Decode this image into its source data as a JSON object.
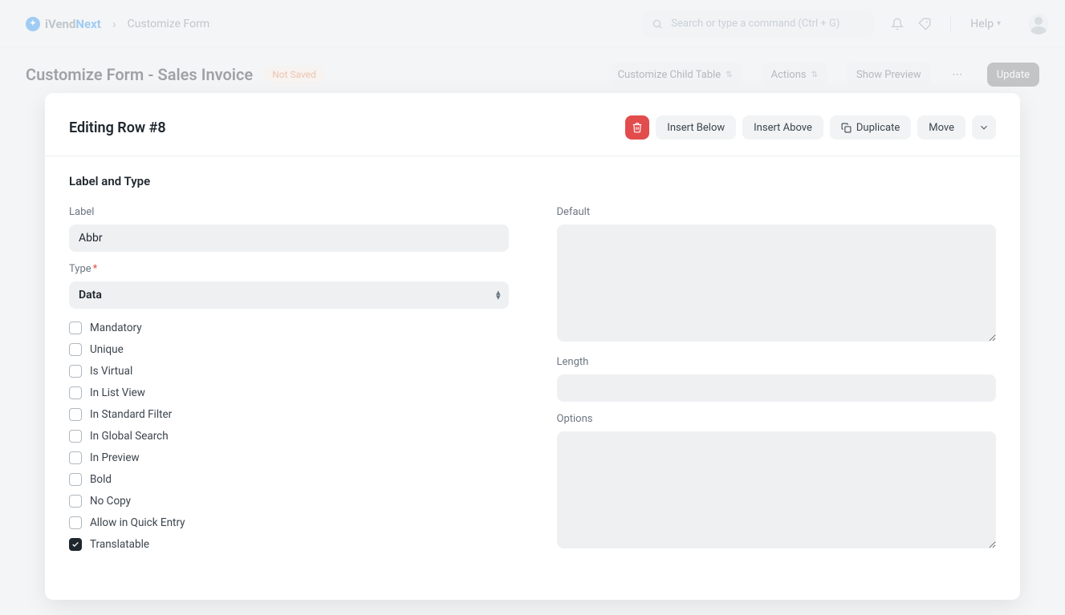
{
  "brand": {
    "name1": "iVend",
    "name2": "Next"
  },
  "breadcrumb": "Customize Form",
  "search": {
    "placeholder": "Search or type a command (Ctrl + G)"
  },
  "help_label": "Help",
  "page": {
    "title": "Customize Form - Sales Invoice",
    "status": "Not Saved",
    "buttons": {
      "child_table": "Customize Child Table",
      "actions": "Actions",
      "preview": "Show Preview",
      "update": "Update"
    }
  },
  "panel": {
    "title": "Editing Row #8",
    "actions": {
      "insert_below": "Insert Below",
      "insert_above": "Insert Above",
      "duplicate": "Duplicate",
      "move": "Move"
    },
    "section": "Label and Type",
    "left": {
      "label_field": {
        "label": "Label",
        "value": "Abbr"
      },
      "type_field": {
        "label": "Type",
        "value": "Data",
        "required": true
      }
    },
    "right": {
      "default": "Default",
      "length": "Length",
      "options": "Options"
    },
    "checks": [
      {
        "label": "Mandatory",
        "checked": false
      },
      {
        "label": "Unique",
        "checked": false
      },
      {
        "label": "Is Virtual",
        "checked": false
      },
      {
        "label": "In List View",
        "checked": false
      },
      {
        "label": "In Standard Filter",
        "checked": false
      },
      {
        "label": "In Global Search",
        "checked": false
      },
      {
        "label": "In Preview",
        "checked": false
      },
      {
        "label": "Bold",
        "checked": false
      },
      {
        "label": "No Copy",
        "checked": false
      },
      {
        "label": "Allow in Quick Entry",
        "checked": false
      },
      {
        "label": "Translatable",
        "checked": true
      }
    ]
  }
}
